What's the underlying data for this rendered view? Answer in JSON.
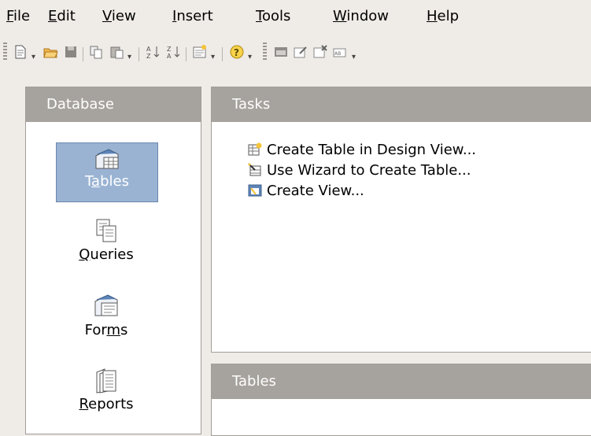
{
  "menubar": {
    "items": [
      {
        "pre": "",
        "u": "F",
        "post": "ile"
      },
      {
        "pre": "",
        "u": "E",
        "post": "dit"
      },
      {
        "pre": "",
        "u": "V",
        "post": "iew"
      },
      {
        "pre": "",
        "u": "I",
        "post": "nsert"
      },
      {
        "pre": "",
        "u": "T",
        "post": "ools"
      },
      {
        "pre": "",
        "u": "W",
        "post": "indow"
      },
      {
        "pre": "",
        "u": "H",
        "post": "elp"
      }
    ]
  },
  "toolbar": {
    "icons": [
      "new-document-icon",
      "open-folder-icon",
      "save-icon",
      "copy-icon",
      "paste-icon",
      "sort-ascending-icon",
      "sort-descending-icon",
      "form-icon",
      "help-icon",
      "new-form-icon",
      "edit-form-icon",
      "delete-form-icon",
      "rename-form-icon"
    ]
  },
  "database_panel": {
    "title": "Database",
    "items": [
      {
        "pre": "T",
        "u": "a",
        "post": "bles"
      },
      {
        "pre": "",
        "u": "Q",
        "post": "ueries"
      },
      {
        "pre": "For",
        "u": "m",
        "post": "s"
      },
      {
        "pre": "",
        "u": "R",
        "post": "eports"
      }
    ]
  },
  "tasks_panel": {
    "title": "Tasks",
    "tasks": [
      "Create Table in Design View...",
      "Use Wizard to Create Table...",
      "Create View..."
    ]
  },
  "tables_panel": {
    "title": "Tables"
  },
  "colors": {
    "header": "#a6a29d",
    "selected": "#9ab3d3",
    "background": "#efebe7"
  }
}
